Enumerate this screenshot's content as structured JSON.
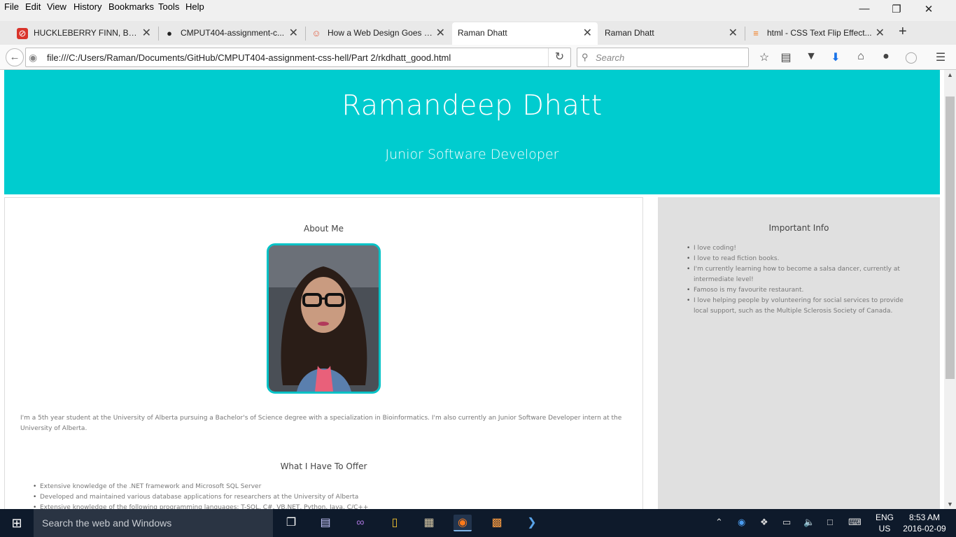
{
  "menubar": {
    "items": [
      "File",
      "Edit",
      "View",
      "History",
      "Bookmarks",
      "Tools",
      "Help"
    ]
  },
  "window_controls": {
    "minimize": "—",
    "restore": "❐",
    "close": "✕"
  },
  "tabs": [
    {
      "title": "HUCKLEBERRY FINN, By ...",
      "icon": "⊘",
      "icon_color": "#d9342b"
    },
    {
      "title": "CMPUT404-assignment-c...",
      "icon": "●",
      "icon_color": "#222222"
    },
    {
      "title": "How a Web Design Goes S...",
      "icon": "☺",
      "icon_color": "#e35d3f"
    },
    {
      "title": "Raman Dhatt",
      "icon": "",
      "icon_color": "#ffffff"
    },
    {
      "title": "Raman Dhatt",
      "icon": "",
      "icon_color": "#ffffff"
    },
    {
      "title": "html - CSS Text Flip Effect...",
      "icon": "≡",
      "icon_color": "#f48024"
    }
  ],
  "tab_close_glyph": "✕",
  "new_tab_glyph": "+",
  "navbar": {
    "url": "file:///C:/Users/Raman/Documents/GitHub/CMPUT404-assignment-css-hell/Part 2/rkdhatt_good.html",
    "search_placeholder": "Search"
  },
  "page": {
    "name": "Ramandeep Dhatt",
    "subtitle": "Junior Software Developer",
    "about_heading": "About Me",
    "about_text": "I'm a 5th year student at the University of Alberta pursuing a Bachelor's of Science degree with a specialization in Bioinformatics. I'm also currently an Junior Software Developer intern at the University of Alberta.",
    "offer_heading": "What I Have To Offer",
    "offer_items": [
      "Extensive knowledge of the .NET framework and Microsoft SQL Server",
      "Developed and maintained various database applications for researchers at the University of Alberta",
      "Extensive knowledge of the following programming languages: T-SQL, C#, VB.NET, Python, Java, C/C++"
    ],
    "info_heading": "Important Info",
    "info_items": [
      "I love coding!",
      "I love to read fiction books.",
      "I'm currently learning how to become a salsa dancer, currently at intermediate level!",
      "Famoso is my favourite restaurant.",
      "I love helping people by volunteering for social services to provide local support, such as the Multiple Sclerosis Society of Canada."
    ]
  },
  "colors": {
    "header_bg": "#00cccf",
    "sidebar_bg": "#e0e0e0",
    "photo_border": "#00c2c6",
    "taskbar_bg": "#0e1a2b"
  },
  "taskbar": {
    "search_placeholder": "Search the web and Windows",
    "language": "ENG",
    "region": "US",
    "time": "8:53 AM",
    "date": "2016-02-09"
  }
}
